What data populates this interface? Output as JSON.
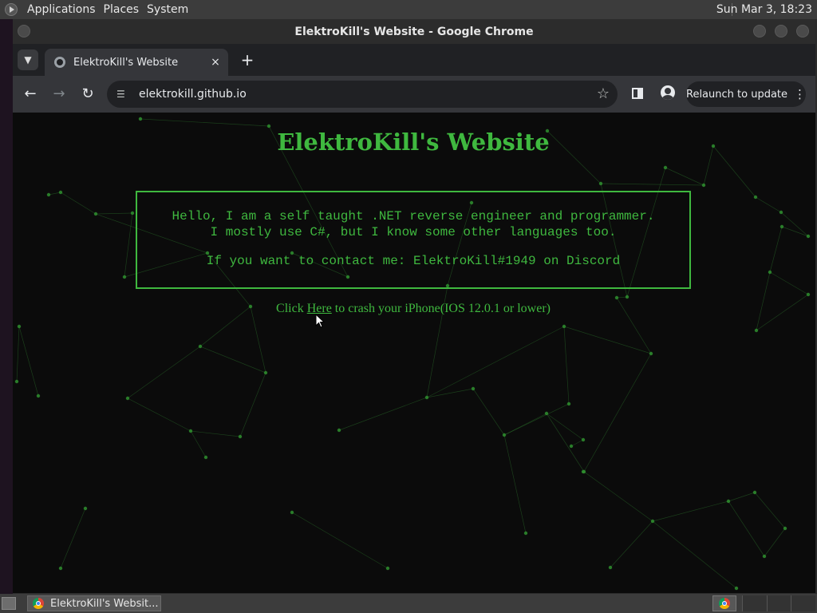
{
  "top_panel": {
    "menus": [
      "Applications",
      "Places",
      "System"
    ],
    "clock": "Sun Mar  3, 18:23"
  },
  "window": {
    "title": "ElektroKill's Website - Google Chrome"
  },
  "browser": {
    "tab_title": "ElektroKill's Website",
    "tab_close": "×",
    "new_tab": "+",
    "url": "elektrokill.github.io",
    "relaunch_label": "Relaunch to update"
  },
  "page": {
    "title": "ElektroKill's Website",
    "intro_line1": "Hello, I am a self taught .NET reverse engineer and programmer.",
    "intro_line2": "I mostly use C#, but I know some other languages too.",
    "contact_line": "If you want to contact me: ElektroKill#1949 on Discord",
    "crash_prefix": "Click ",
    "crash_link": "Here",
    "crash_suffix": " to crash your iPhone(IOS 12.0.1 or lower)",
    "accent_color": "#3fb83f",
    "background_color": "#0b0b0b"
  },
  "taskbar": {
    "task_label": "ElektroKill's Websit..."
  }
}
